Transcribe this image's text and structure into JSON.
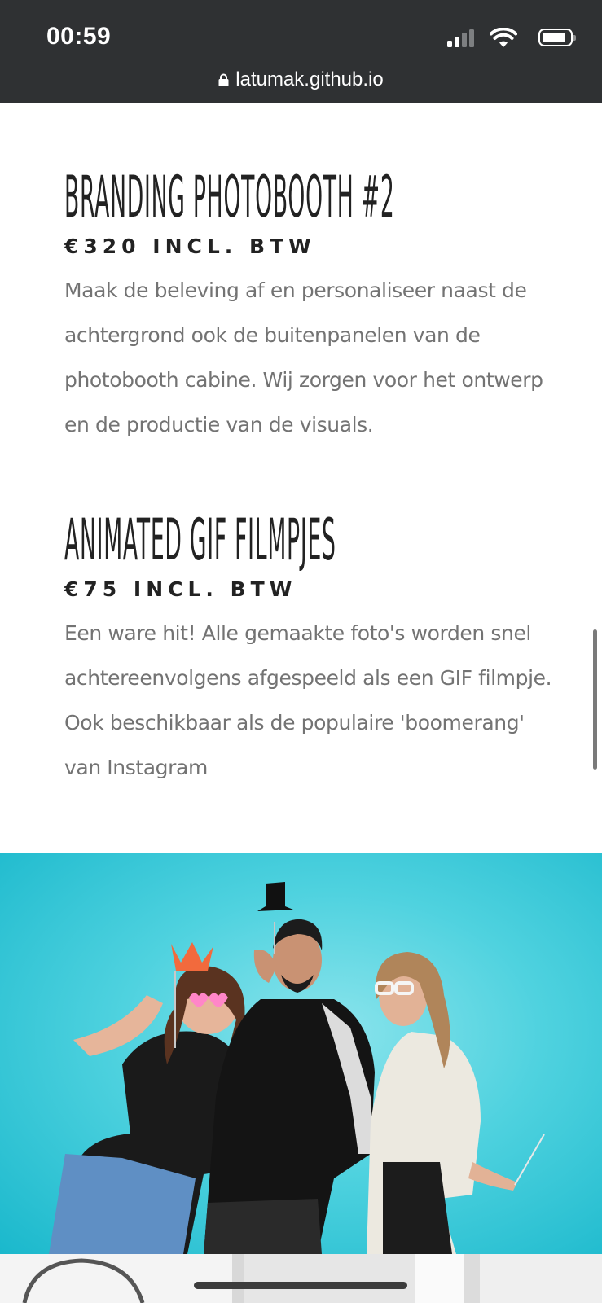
{
  "status_bar": {
    "time": "00:59",
    "url": "latumak.github.io",
    "icons": [
      "signal-icon",
      "wifi-icon",
      "battery-icon",
      "lock-icon"
    ]
  },
  "sections": [
    {
      "title": "BRANDING PHOTOBOOTH #2",
      "price": "€320 INCL. BTW",
      "description": "Maak de beleving af en personaliseer naast de achtergrond ook de buitenpanelen van de photobooth cabine. Wij zorgen voor het ontwerp en de productie van de visuals."
    },
    {
      "title": "ANIMATED GIF FILMPJES",
      "price": "€75 INCL. BTW",
      "description": "Een ware hit! Alle gemaakte foto's worden snel achtereenvolgens afgespeeld als een GIF filmpje. Ook beschikbaar als de populaire 'boomerang' van Instagram"
    }
  ],
  "colors": {
    "status_bar_bg": "#2f3133",
    "heading": "#222222",
    "body_text": "#737373",
    "photo_bg": "#4fd2df"
  }
}
